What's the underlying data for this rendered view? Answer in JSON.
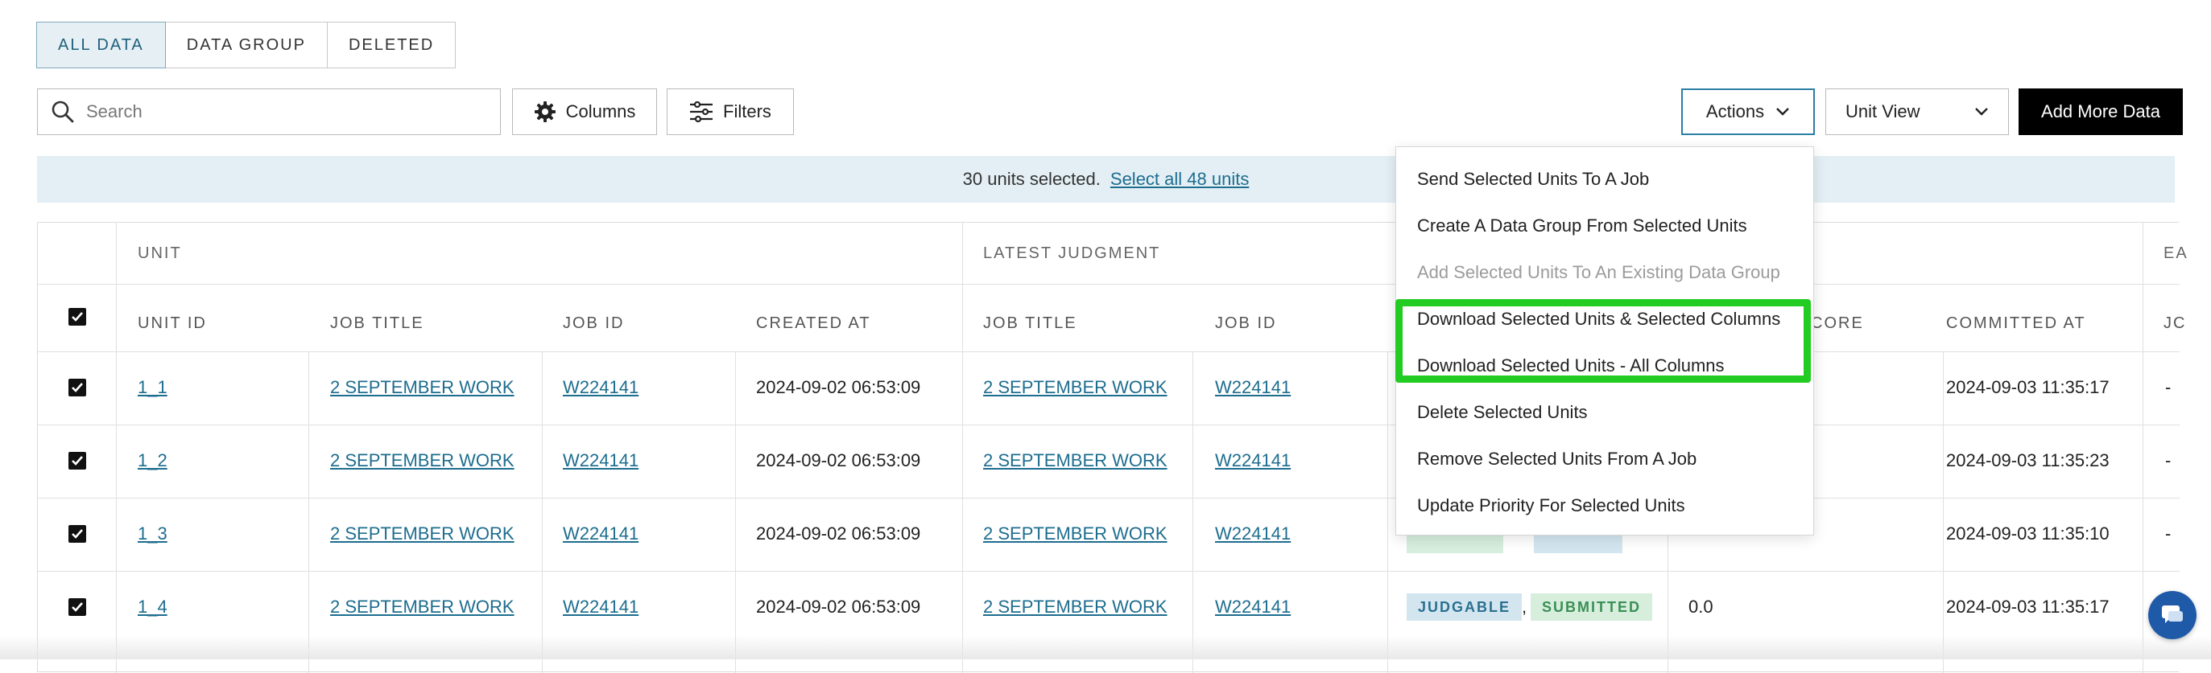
{
  "tabs": [
    {
      "label": "ALL DATA",
      "active": true
    },
    {
      "label": "DATA GROUP",
      "active": false
    },
    {
      "label": "DELETED",
      "active": false
    }
  ],
  "toolbar": {
    "search_placeholder": "Search",
    "columns_label": "Columns",
    "filters_label": "Filters",
    "actions_label": "Actions",
    "view_select_value": "Unit View",
    "add_label": "Add More Data"
  },
  "banner": {
    "selected_text": "30 units selected.",
    "select_all_link": "Select all 48 units"
  },
  "table": {
    "groups": {
      "unit": "UNIT",
      "latest": "LATEST JUDGMENT",
      "partial": "EA"
    },
    "headers": {
      "unit_id": "UNIT ID",
      "job_title": "JOB TITLE",
      "job_id": "JOB ID",
      "created_at": "CREATED AT",
      "lj_job_title": "JOB TITLE",
      "lj_job_id": "JOB ID",
      "score": "CORE",
      "committed_at": "COMMITTED AT",
      "partial": "JC"
    },
    "rows": [
      {
        "unit_id": "1_1",
        "job_title": "2 SEPTEMBER WORK",
        "job_id": "W224141",
        "created_at": "2024-09-02 06:53:09",
        "lj_job_title": "2 SEPTEMBER WORK",
        "lj_job_id": "W224141",
        "committed_at": "2024-09-03 11:35:17",
        "extra": "-"
      },
      {
        "unit_id": "1_2",
        "job_title": "2 SEPTEMBER WORK",
        "job_id": "W224141",
        "created_at": "2024-09-02 06:53:09",
        "lj_job_title": "2 SEPTEMBER WORK",
        "lj_job_id": "W224141",
        "committed_at": "2024-09-03 11:35:23",
        "extra": "-"
      },
      {
        "unit_id": "1_3",
        "job_title": "2 SEPTEMBER WORK",
        "job_id": "W224141",
        "created_at": "2024-09-02 06:53:09",
        "lj_job_title": "2 SEPTEMBER WORK",
        "lj_job_id": "W224141",
        "committed_at": "2024-09-03 11:35:10",
        "extra": "-"
      },
      {
        "unit_id": "1_4",
        "job_title": "2 SEPTEMBER WORK",
        "job_id": "W224141",
        "created_at": "2024-09-02 06:53:09",
        "lj_job_title": "2 SEPTEMBER WORK",
        "lj_job_id": "W224141",
        "status_1": "JUDGABLE",
        "status_2": "SUBMITTED",
        "separator": ",",
        "score": "0.0",
        "committed_at": "2024-09-03 11:35:17",
        "extra": "-"
      }
    ]
  },
  "actions_menu": {
    "items": [
      {
        "label": "Send Selected Units To A Job",
        "disabled": false
      },
      {
        "label": "Create A Data Group From Selected Units",
        "disabled": false
      },
      {
        "label": "Add Selected Units To An Existing Data Group",
        "disabled": true
      },
      {
        "label": "Download Selected Units & Selected Columns",
        "disabled": false
      },
      {
        "label": "Download Selected Units - All Columns",
        "disabled": false
      },
      {
        "label": "Delete Selected Units",
        "disabled": false
      },
      {
        "label": "Remove Selected Units From A Job",
        "disabled": false
      },
      {
        "label": "Update Priority For Selected Units",
        "disabled": false
      }
    ]
  },
  "colors": {
    "accent": "#1d6d8f",
    "highlight": "#22cc22",
    "banner_bg": "#e3eff4",
    "badge_blue": "#d3e6ef",
    "badge_green": "#d7eedd"
  }
}
